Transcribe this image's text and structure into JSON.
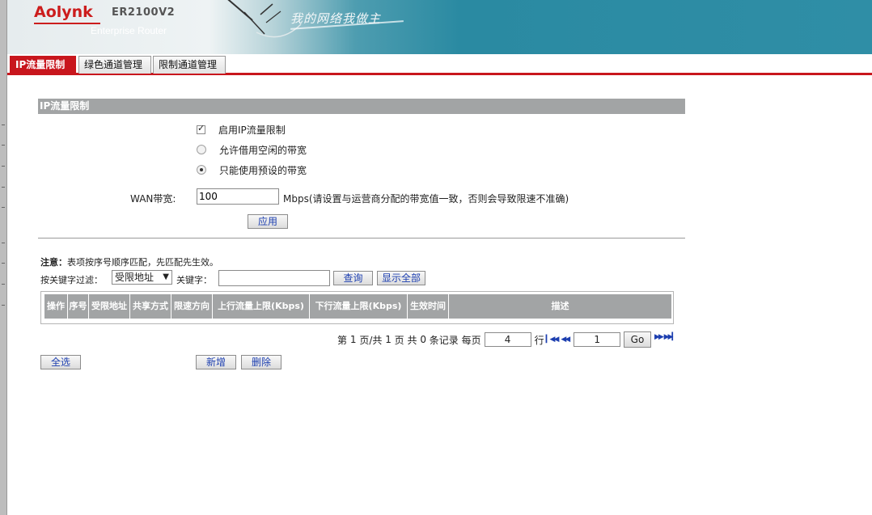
{
  "header": {
    "brand": "Aolynk",
    "model": "ER2100V2",
    "subtitle": "Enterprise Router",
    "slogan": "我的网络我做主"
  },
  "tabs": [
    {
      "label": "IP流量限制",
      "active": true
    },
    {
      "label": "绿色通道管理",
      "active": false
    },
    {
      "label": "限制通道管理",
      "active": false
    }
  ],
  "section": {
    "title": "IP流量限制"
  },
  "options": {
    "enable_label": "启用IP流量限制",
    "enable_checked": true,
    "borrow_label": "允许借用空闲的带宽",
    "borrow_selected": false,
    "preset_label": "只能使用预设的带宽",
    "preset_selected": true
  },
  "wan": {
    "label": "WAN带宽:",
    "value": "100",
    "note": "Mbps(请设置与运营商分配的带宽值一致，否则会导致限速不准确)"
  },
  "apply_label": "应用",
  "notice": {
    "prefix": "注意：",
    "text": "表项按序号顺序匹配，先匹配先生效。"
  },
  "filter": {
    "label": "按关键字过滤：",
    "select_value": "受限地址",
    "keyword_label": "关键字：",
    "keyword_value": "",
    "query_label": "查询",
    "show_all_label": "显示全部"
  },
  "table": {
    "columns": [
      "操作",
      "序号",
      "受限地址",
      "共享方式",
      "限速方向",
      "上行流量上限(Kbps)",
      "下行流量上限(Kbps)",
      "生效时间",
      "描述"
    ],
    "rows": []
  },
  "pager": {
    "prefix": "第",
    "current": "1",
    "mid": "页/共",
    "total_pages": "1",
    "mid2": "页 共",
    "records": "0",
    "suffix": "条记录 每页",
    "per_page": "4",
    "rows_label": "行",
    "goto_value": "1",
    "go_label": "Go"
  },
  "actions": {
    "select_all": "全选",
    "add": "新增",
    "delete": "删除"
  },
  "colors": {
    "accent_red": "#c8161d",
    "header_gray": "#a2a4a5",
    "link_blue": "#1d3fb0"
  }
}
